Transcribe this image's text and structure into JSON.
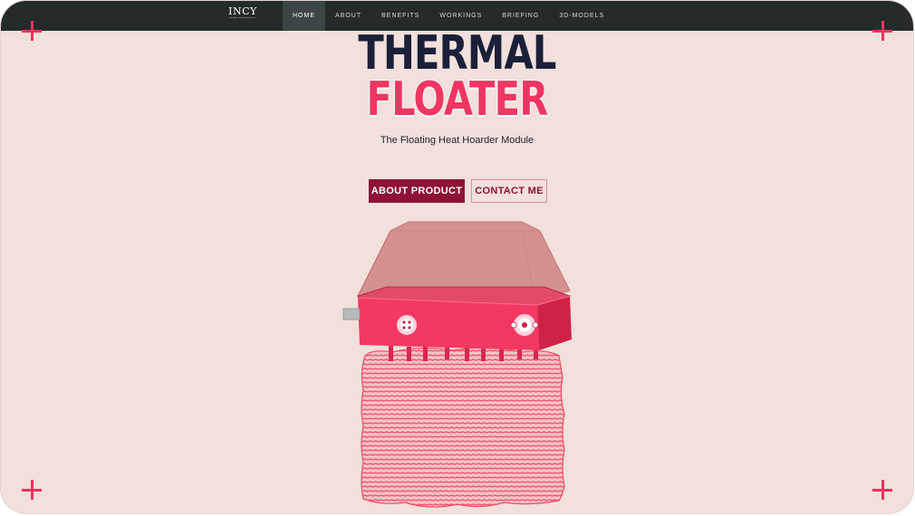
{
  "brand": {
    "logo_text": "INCY",
    "logo_tagline": "INTERACTIVE DESIGN & CO."
  },
  "nav": {
    "items": [
      {
        "label": "HOME",
        "active": true
      },
      {
        "label": "ABOUT",
        "active": false
      },
      {
        "label": "BENEFITS",
        "active": false
      },
      {
        "label": "WORKINGS",
        "active": false
      },
      {
        "label": "BRIEFING",
        "active": false
      },
      {
        "label": "3D-MODELS",
        "active": false
      }
    ]
  },
  "hero": {
    "title_line1": "THERMAL",
    "title_line2": "FLOATER",
    "subtitle": "The Floating Heat Hoarder Module",
    "primary_button": "ABOUT PRODUCT",
    "secondary_button": "CONTACT ME"
  },
  "colors": {
    "background": "#f1e0db",
    "navbar": "#252a2b",
    "accent": "#f13562",
    "title_dark": "#1b1f38",
    "button_primary": "#8d1236"
  },
  "icons": {
    "corner_markers": "plus-crosshair-icon",
    "product_render": "thermal-floater-3d-model"
  }
}
